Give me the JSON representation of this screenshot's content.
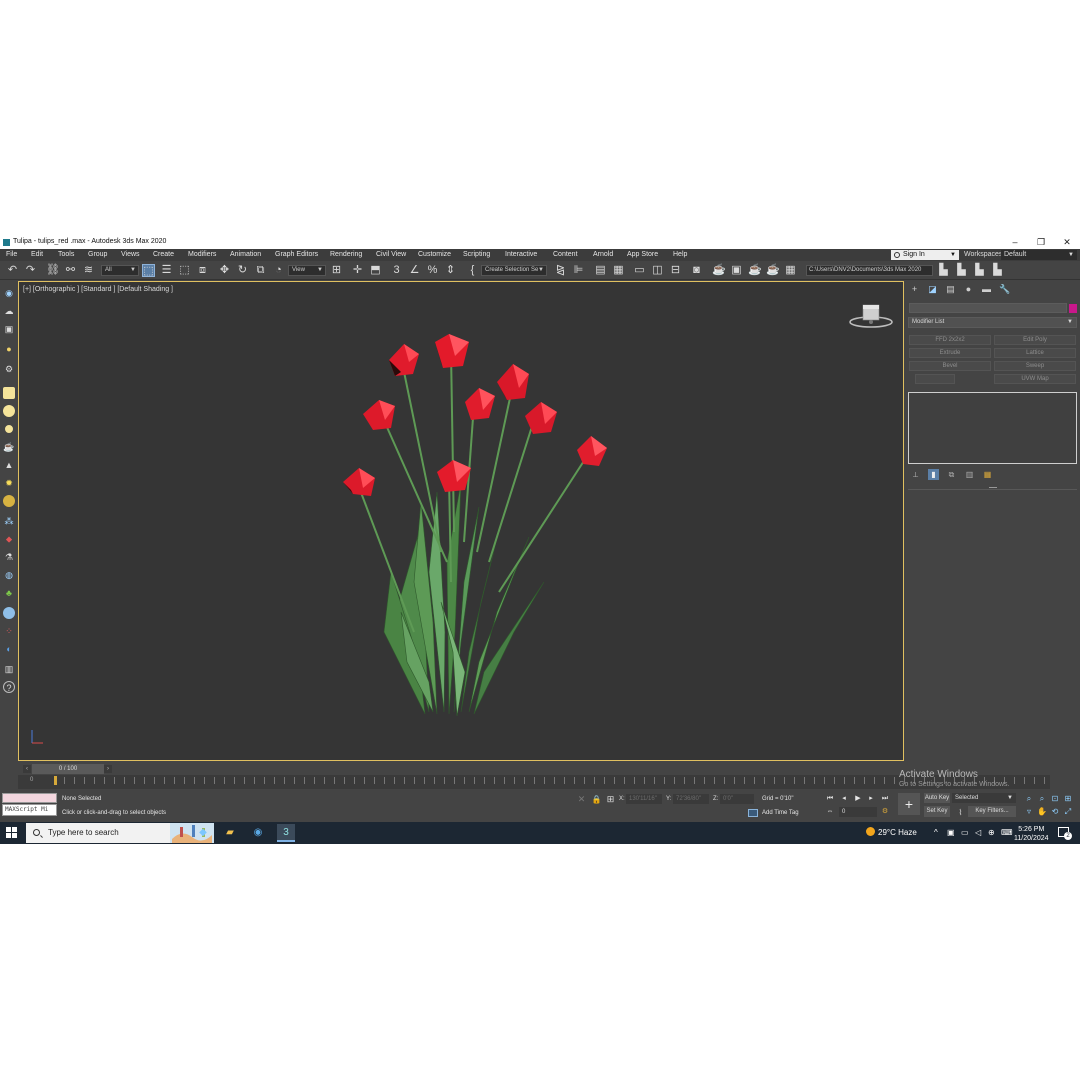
{
  "window": {
    "title": "Tulipa - tulips_red .max - Autodesk 3ds Max 2020",
    "controls": [
      "–",
      "❐",
      "✕"
    ]
  },
  "menu": {
    "items": [
      "File",
      "Edit",
      "Tools",
      "Group",
      "Views",
      "Create",
      "Modifiers",
      "Animation",
      "Graph Editors",
      "Rendering",
      "Civil View",
      "Customize",
      "Scripting",
      "Interactive",
      "Content",
      "Arnold",
      "App Store",
      "Help"
    ],
    "sign_in": "Sign In",
    "workspaces_label": "Workspaces:",
    "workspace_value": "Default"
  },
  "toolbar": {
    "selection_filter": "All",
    "reference_coord": "View",
    "named_selection": "Create Selection Se",
    "project_path": "C:\\Users\\DNV2\\Documents\\3ds Max 2020"
  },
  "viewport": {
    "label": "[+] [Orthographic ] [Standard ] [Default Shading ]"
  },
  "command_panel": {
    "modifier_list": "Modifier List",
    "modifier_buttons": [
      "FFD 2x2x2",
      "Edit Poly",
      "Extrude",
      "Lattice",
      "Bevel",
      "Sweep",
      "",
      "UVW Map"
    ],
    "accent_color": "#c9188b"
  },
  "timeline": {
    "frame_readout": "0 / 100",
    "trackbar_start": "0"
  },
  "status": {
    "maxscript": "MAXScript Mi",
    "selection": "None Selected",
    "prompt": "Click or click-and-drag to select objects",
    "x_label": "X:",
    "x_value": "130'11/16\"",
    "y_label": "Y:",
    "y_value": "72'36/80\"",
    "z_label": "Z:",
    "z_value": "0'0\"",
    "grid": "Grid = 0'10\"",
    "add_time_tag": "Add Time Tag",
    "frame_field": "0",
    "auto_key": "Auto Key",
    "set_key": "Set Key",
    "key_mode": "Selected",
    "key_filters": "Key Filters..."
  },
  "watermark": {
    "line1": "Activate Windows",
    "line2": "Go to Settings to activate Windows."
  },
  "taskbar": {
    "search_placeholder": "Type here to search",
    "weather": "29°C  Haze",
    "time": "5:26 PM",
    "date": "11/20/2024",
    "notifications": "2"
  }
}
